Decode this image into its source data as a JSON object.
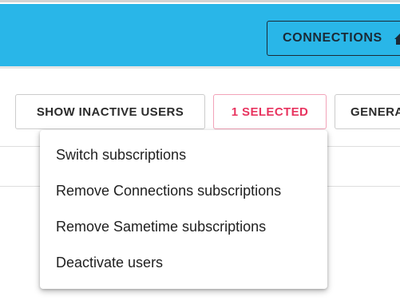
{
  "header": {
    "connections_label": "CONNECTIONS",
    "home_icon": "home-icon",
    "background_color": "#29b6e8"
  },
  "toolbar": {
    "show_inactive_label": "SHOW INACTIVE USERS",
    "selected_label": "1 SELECTED",
    "general_label": "GENERA",
    "selected_accent_color": "#e8345f"
  },
  "menu": {
    "items": [
      {
        "label": "Switch subscriptions"
      },
      {
        "label": "Remove Connections subscriptions"
      },
      {
        "label": "Remove Sametime subscriptions"
      },
      {
        "label": "Deactivate users"
      }
    ]
  }
}
